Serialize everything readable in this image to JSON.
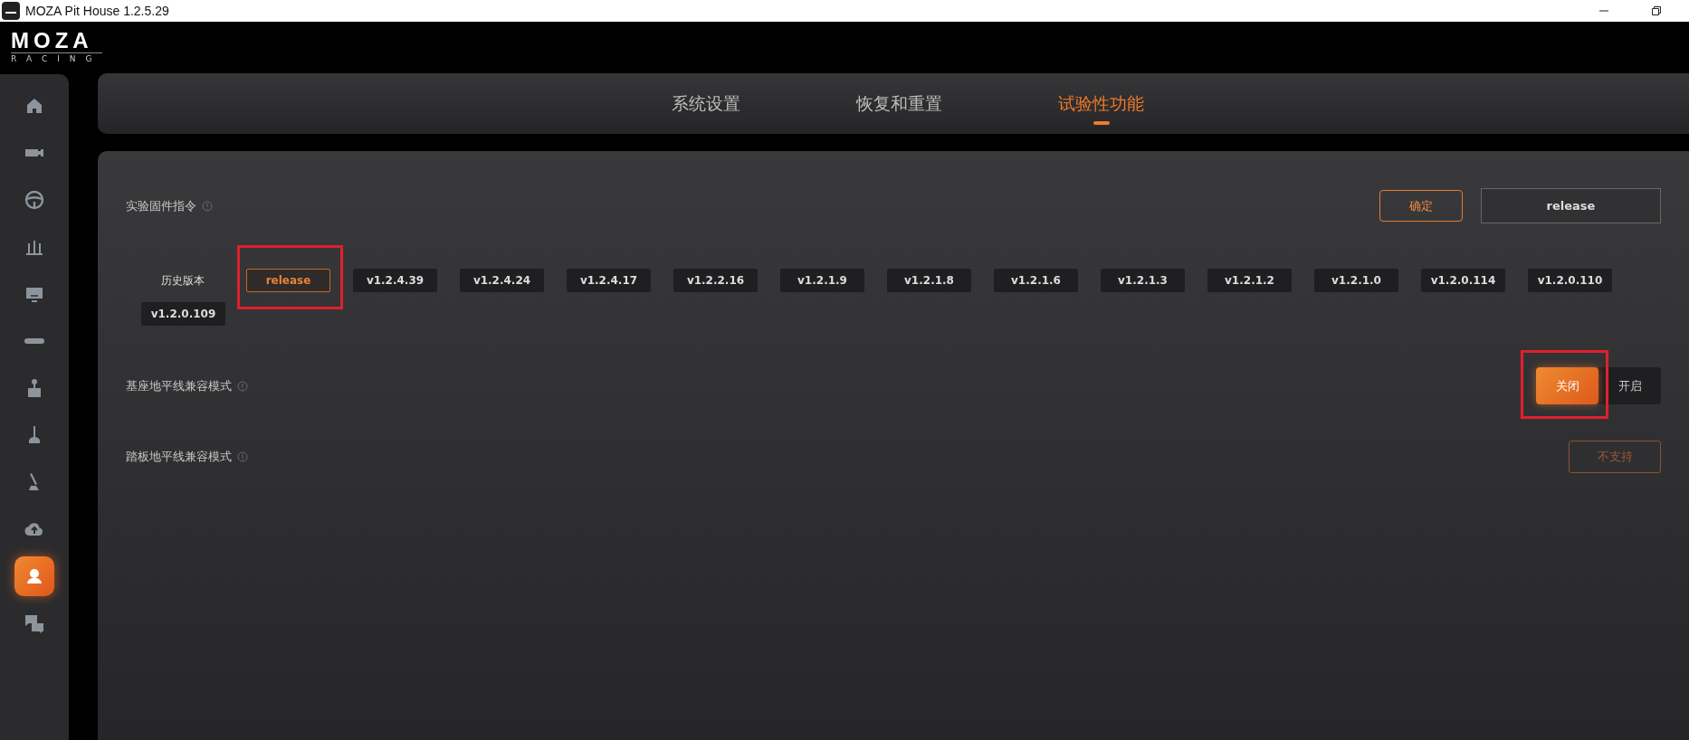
{
  "window": {
    "title": "MOZA Pit House 1.2.5.29"
  },
  "logo": {
    "brand": "MOZA",
    "sub": "RACING"
  },
  "sidebar": {
    "items": [
      {
        "kind": "home",
        "selected": false
      },
      {
        "kind": "wheelbase",
        "selected": false
      },
      {
        "kind": "wheel",
        "selected": false
      },
      {
        "kind": "pedals",
        "selected": false
      },
      {
        "kind": "dashboard",
        "selected": false
      },
      {
        "kind": "hub",
        "selected": false
      },
      {
        "kind": "stick",
        "selected": false
      },
      {
        "kind": "shifter",
        "selected": false
      },
      {
        "kind": "handbrake",
        "selected": false
      },
      {
        "kind": "cloud",
        "selected": false
      },
      {
        "kind": "user",
        "selected": true
      },
      {
        "kind": "qa",
        "selected": false
      }
    ]
  },
  "tabs": [
    {
      "label": "系统设置",
      "selected": false
    },
    {
      "label": "恢复和重置",
      "selected": false
    },
    {
      "label": "试验性功能",
      "selected": true
    }
  ],
  "firmware": {
    "label": "实验固件指令",
    "confirm": "确定",
    "value": "release"
  },
  "history": {
    "label": "历史版本",
    "versions": [
      {
        "label": "release",
        "selected": true,
        "highlighted": true
      },
      {
        "label": "v1.2.4.39",
        "selected": false,
        "highlighted": false
      },
      {
        "label": "v1.2.4.24",
        "selected": false,
        "highlighted": false
      },
      {
        "label": "v1.2.4.17",
        "selected": false,
        "highlighted": false
      },
      {
        "label": "v1.2.2.16",
        "selected": false,
        "highlighted": false
      },
      {
        "label": "v1.2.1.9",
        "selected": false,
        "highlighted": false
      },
      {
        "label": "v1.2.1.8",
        "selected": false,
        "highlighted": false
      },
      {
        "label": "v1.2.1.6",
        "selected": false,
        "highlighted": false
      },
      {
        "label": "v1.2.1.3",
        "selected": false,
        "highlighted": false
      },
      {
        "label": "v1.2.1.2",
        "selected": false,
        "highlighted": false
      },
      {
        "label": "v1.2.1.0",
        "selected": false,
        "highlighted": false
      },
      {
        "label": "v1.2.0.114",
        "selected": false,
        "highlighted": false
      },
      {
        "label": "v1.2.0.110",
        "selected": false,
        "highlighted": false
      },
      {
        "label": "v1.2.0.109",
        "selected": false,
        "highlighted": false
      }
    ]
  },
  "base_horizon": {
    "label": "基座地平线兼容模式",
    "options": [
      {
        "label": "关闭",
        "selected": true,
        "highlighted": true
      },
      {
        "label": "开启",
        "selected": false,
        "highlighted": false
      }
    ]
  },
  "pedal_horizon": {
    "label": "踏板地平线兼容模式",
    "button": {
      "label": "不支持",
      "disabled": true
    }
  }
}
